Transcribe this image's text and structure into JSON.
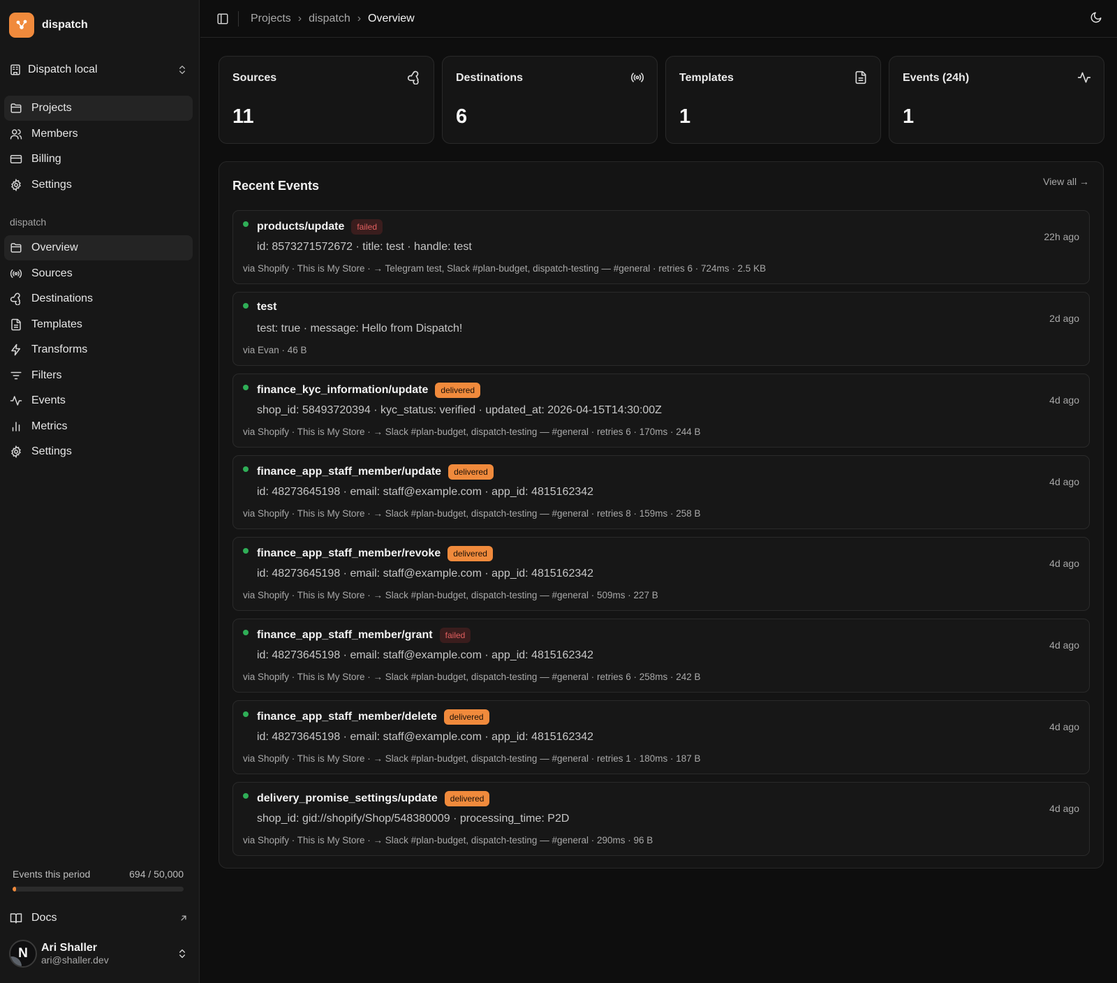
{
  "brand": {
    "name": "dispatch",
    "accent": "#f08a3c"
  },
  "workspace": {
    "name": "Dispatch local"
  },
  "nav_top": [
    {
      "label": "Projects",
      "icon": "folder-icon",
      "active": true
    },
    {
      "label": "Members",
      "icon": "users-icon",
      "active": false
    },
    {
      "label": "Billing",
      "icon": "credit-card-icon",
      "active": false
    },
    {
      "label": "Settings",
      "icon": "gear-icon",
      "active": false
    }
  ],
  "project_section": {
    "label": "dispatch"
  },
  "nav_project": [
    {
      "label": "Overview",
      "icon": "folder-icon",
      "active": true
    },
    {
      "label": "Sources",
      "icon": "radio-icon",
      "active": false
    },
    {
      "label": "Destinations",
      "icon": "webhook-icon",
      "active": false
    },
    {
      "label": "Templates",
      "icon": "document-icon",
      "active": false
    },
    {
      "label": "Transforms",
      "icon": "bolt-icon",
      "active": false
    },
    {
      "label": "Filters",
      "icon": "filter-icon",
      "active": false
    },
    {
      "label": "Events",
      "icon": "activity-icon",
      "active": false
    },
    {
      "label": "Metrics",
      "icon": "bar-chart-icon",
      "active": false
    },
    {
      "label": "Settings",
      "icon": "gear-icon",
      "active": false
    }
  ],
  "usage": {
    "label": "Events this period",
    "value_text": "694 / 50,000",
    "fraction": 0.01388
  },
  "docs": {
    "label": "Docs"
  },
  "user": {
    "initial": "N",
    "name": "Ari Shaller",
    "email": "ari@shaller.dev"
  },
  "breadcrumb": {
    "items": [
      "Projects",
      "dispatch"
    ],
    "current": "Overview",
    "separator": "›"
  },
  "stats": [
    {
      "title": "Sources",
      "value": "11",
      "icon": "webhook-icon"
    },
    {
      "title": "Destinations",
      "value": "6",
      "icon": "radio-icon"
    },
    {
      "title": "Templates",
      "value": "1",
      "icon": "document-icon"
    },
    {
      "title": "Events (24h)",
      "value": "1",
      "icon": "activity-icon"
    }
  ],
  "recent_events": {
    "title": "Recent Events",
    "view_all": "View all →",
    "items": [
      {
        "name": "products/update",
        "status": "failed",
        "summary": "id: 8573271572672 · title: test · handle: test",
        "meta": "via Shopify · This is My Store · → Telegram test, Slack #plan-budget, dispatch-testing — #general · retries 6 · 724ms · 2.5 KB",
        "time": "22h ago"
      },
      {
        "name": "test",
        "status": "",
        "summary": "test: true · message: Hello from Dispatch!",
        "meta": "via Evan · 46 B",
        "time": "2d ago"
      },
      {
        "name": "finance_kyc_information/update",
        "status": "delivered",
        "summary": "shop_id: 58493720394 · kyc_status: verified · updated_at: 2026-04-15T14:30:00Z",
        "meta": "via Shopify · This is My Store · → Slack #plan-budget, dispatch-testing — #general · retries 6 · 170ms · 244 B",
        "time": "4d ago"
      },
      {
        "name": "finance_app_staff_member/update",
        "status": "delivered",
        "summary": "id: 48273645198 · email: staff@example.com · app_id: 4815162342",
        "meta": "via Shopify · This is My Store · → Slack #plan-budget, dispatch-testing — #general · retries 8 · 159ms · 258 B",
        "time": "4d ago"
      },
      {
        "name": "finance_app_staff_member/revoke",
        "status": "delivered",
        "summary": "id: 48273645198 · email: staff@example.com · app_id: 4815162342",
        "meta": "via Shopify · This is My Store · → Slack #plan-budget, dispatch-testing — #general · 509ms · 227 B",
        "time": "4d ago"
      },
      {
        "name": "finance_app_staff_member/grant",
        "status": "failed",
        "summary": "id: 48273645198 · email: staff@example.com · app_id: 4815162342",
        "meta": "via Shopify · This is My Store · → Slack #plan-budget, dispatch-testing — #general · retries 6 · 258ms · 242 B",
        "time": "4d ago"
      },
      {
        "name": "finance_app_staff_member/delete",
        "status": "delivered",
        "summary": "id: 48273645198 · email: staff@example.com · app_id: 4815162342",
        "meta": "via Shopify · This is My Store · → Slack #plan-budget, dispatch-testing — #general · retries 1 · 180ms · 187 B",
        "time": "4d ago"
      },
      {
        "name": "delivery_promise_settings/update",
        "status": "delivered",
        "summary": "shop_id: gid://shopify/Shop/548380009 · processing_time: P2D",
        "meta": "via Shopify · This is My Store · → Slack #plan-budget, dispatch-testing — #general · 290ms · 96 B",
        "time": "4d ago"
      }
    ]
  }
}
